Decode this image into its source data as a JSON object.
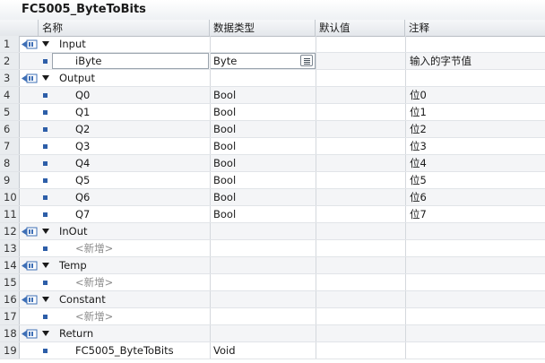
{
  "title": "FC5005_ByteToBits",
  "columns": {
    "name": "名称",
    "data_type": "数据类型",
    "default": "默认值",
    "comment": "注释"
  },
  "rows": [
    {
      "num": "1",
      "kind": "section",
      "io": "in-icon",
      "name": "Input",
      "data_type": "",
      "default": "",
      "comment": ""
    },
    {
      "num": "2",
      "kind": "var",
      "name": "iByte",
      "data_type": "Byte",
      "default": "",
      "comment": "输入的字节值",
      "editing": true
    },
    {
      "num": "3",
      "kind": "section",
      "io": "out-icon",
      "name": "Output",
      "data_type": "",
      "default": "",
      "comment": ""
    },
    {
      "num": "4",
      "kind": "var",
      "name": "Q0",
      "data_type": "Bool",
      "default": "",
      "comment": "位0"
    },
    {
      "num": "5",
      "kind": "var",
      "name": "Q1",
      "data_type": "Bool",
      "default": "",
      "comment": "位1"
    },
    {
      "num": "6",
      "kind": "var",
      "name": "Q2",
      "data_type": "Bool",
      "default": "",
      "comment": "位2"
    },
    {
      "num": "7",
      "kind": "var",
      "name": "Q3",
      "data_type": "Bool",
      "default": "",
      "comment": "位3"
    },
    {
      "num": "8",
      "kind": "var",
      "name": "Q4",
      "data_type": "Bool",
      "default": "",
      "comment": "位4"
    },
    {
      "num": "9",
      "kind": "var",
      "name": "Q5",
      "data_type": "Bool",
      "default": "",
      "comment": "位5"
    },
    {
      "num": "10",
      "kind": "var",
      "name": "Q6",
      "data_type": "Bool",
      "default": "",
      "comment": "位6"
    },
    {
      "num": "11",
      "kind": "var",
      "name": "Q7",
      "data_type": "Bool",
      "default": "",
      "comment": "位7"
    },
    {
      "num": "12",
      "kind": "section",
      "io": "inout-icon",
      "name": "InOut",
      "data_type": "",
      "default": "",
      "comment": ""
    },
    {
      "num": "13",
      "kind": "add",
      "name": "<新增>",
      "data_type": "",
      "default": "",
      "comment": ""
    },
    {
      "num": "14",
      "kind": "section",
      "io": "temp-icon",
      "name": "Temp",
      "data_type": "",
      "default": "",
      "comment": ""
    },
    {
      "num": "15",
      "kind": "add",
      "name": "<新增>",
      "data_type": "",
      "default": "",
      "comment": ""
    },
    {
      "num": "16",
      "kind": "section",
      "io": "const-icon",
      "name": "Constant",
      "data_type": "",
      "default": "",
      "comment": ""
    },
    {
      "num": "17",
      "kind": "add",
      "name": "<新增>",
      "data_type": "",
      "default": "",
      "comment": ""
    },
    {
      "num": "18",
      "kind": "section",
      "io": "return-icon",
      "name": "Return",
      "data_type": "",
      "default": "",
      "comment": ""
    },
    {
      "num": "19",
      "kind": "var",
      "name": "FC5005_ByteToBits",
      "data_type": "Void",
      "default": "",
      "comment": ""
    }
  ],
  "colors": {
    "accent": "#2d5ea8",
    "icon": "#3e6fb6"
  }
}
